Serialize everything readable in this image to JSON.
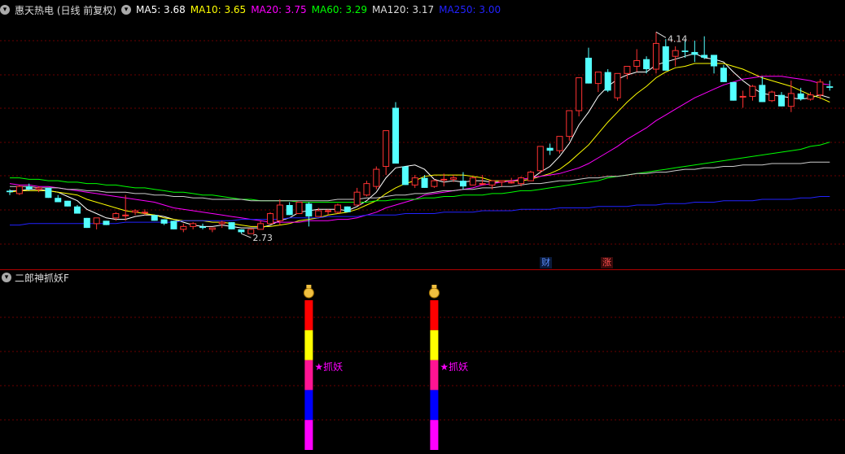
{
  "header": {
    "stock_title": "惠天热电 (日线 前复权)",
    "ma": [
      {
        "label": "MA5: 3.68",
        "color": "#ffffff"
      },
      {
        "label": "MA10: 3.65",
        "color": "#ffff00"
      },
      {
        "label": "MA20: 3.75",
        "color": "#ff00ff"
      },
      {
        "label": "MA60: 3.29",
        "color": "#00ff00"
      },
      {
        "label": "MA120: 3.17",
        "color": "#dddddd"
      },
      {
        "label": "MA250: 3.00",
        "color": "#2222ff"
      }
    ]
  },
  "price_chart": {
    "price_range": [
      2.6,
      4.25
    ],
    "high_label": "4.14",
    "low_label": "2.73",
    "up_color": "#ff3232",
    "down_color": "#54ffff",
    "candles": [
      [
        3.03,
        3.04,
        3.0,
        3.02
      ],
      [
        3.01,
        3.07,
        3.0,
        3.06
      ],
      [
        3.06,
        3.08,
        3.03,
        3.04
      ],
      [
        3.04,
        3.06,
        3.02,
        3.05
      ],
      [
        3.05,
        3.05,
        2.98,
        2.98
      ],
      [
        2.98,
        3.0,
        2.95,
        2.95
      ],
      [
        2.96,
        2.96,
        2.92,
        2.92
      ],
      [
        2.92,
        2.93,
        2.87,
        2.87
      ],
      [
        2.84,
        2.84,
        2.77,
        2.77
      ],
      [
        2.8,
        2.84,
        2.76,
        2.84
      ],
      [
        2.82,
        2.82,
        2.79,
        2.79
      ],
      [
        2.84,
        2.88,
        2.82,
        2.87
      ],
      [
        2.86,
        3.0,
        2.82,
        2.86
      ],
      [
        2.88,
        2.9,
        2.86,
        2.89
      ],
      [
        2.88,
        2.9,
        2.86,
        2.88
      ],
      [
        2.86,
        2.86,
        2.82,
        2.82
      ],
      [
        2.83,
        2.83,
        2.79,
        2.8
      ],
      [
        2.82,
        2.82,
        2.76,
        2.76
      ],
      [
        2.76,
        2.8,
        2.74,
        2.78
      ],
      [
        2.78,
        2.81,
        2.76,
        2.8
      ],
      [
        2.78,
        2.8,
        2.76,
        2.77
      ],
      [
        2.76,
        2.77,
        2.74,
        2.77
      ],
      [
        2.8,
        2.82,
        2.77,
        2.81
      ],
      [
        2.81,
        2.81,
        2.76,
        2.76
      ],
      [
        2.76,
        2.76,
        2.73,
        2.74
      ],
      [
        2.73,
        2.77,
        2.73,
        2.76
      ],
      [
        2.76,
        2.82,
        2.76,
        2.8
      ],
      [
        2.8,
        2.88,
        2.8,
        2.87
      ],
      [
        2.82,
        2.97,
        2.79,
        2.93
      ],
      [
        2.93,
        2.95,
        2.86,
        2.86
      ],
      [
        2.87,
        2.95,
        2.87,
        2.95
      ],
      [
        2.94,
        2.95,
        2.78,
        2.85
      ],
      [
        2.85,
        2.91,
        2.85,
        2.89
      ],
      [
        2.89,
        2.9,
        2.86,
        2.89
      ],
      [
        2.88,
        2.94,
        2.87,
        2.93
      ],
      [
        2.92,
        2.92,
        2.88,
        2.88
      ],
      [
        2.93,
        3.05,
        2.93,
        3.02
      ],
      [
        3.0,
        3.1,
        2.99,
        3.08
      ],
      [
        3.06,
        3.2,
        3.04,
        3.18
      ],
      [
        3.2,
        3.45,
        3.14,
        3.45
      ],
      [
        3.61,
        3.65,
        3.22,
        3.22
      ],
      [
        3.2,
        3.2,
        3.07,
        3.07
      ],
      [
        3.07,
        3.14,
        3.05,
        3.12
      ],
      [
        3.12,
        3.14,
        3.05,
        3.05
      ],
      [
        3.06,
        3.11,
        3.05,
        3.1
      ],
      [
        3.11,
        3.15,
        3.06,
        3.11
      ],
      [
        3.11,
        3.14,
        3.09,
        3.12
      ],
      [
        3.1,
        3.16,
        3.04,
        3.06
      ],
      [
        3.07,
        3.13,
        3.07,
        3.12
      ],
      [
        3.08,
        3.14,
        3.07,
        3.08
      ],
      [
        3.07,
        3.1,
        3.04,
        3.1
      ],
      [
        3.09,
        3.1,
        3.06,
        3.1
      ],
      [
        3.09,
        3.12,
        3.08,
        3.09
      ],
      [
        3.08,
        3.13,
        3.06,
        3.12
      ],
      [
        3.1,
        3.17,
        3.1,
        3.16
      ],
      [
        3.17,
        3.34,
        3.15,
        3.34
      ],
      [
        3.33,
        3.36,
        3.28,
        3.31
      ],
      [
        3.31,
        3.41,
        3.29,
        3.41
      ],
      [
        3.41,
        3.59,
        3.38,
        3.59
      ],
      [
        3.59,
        3.82,
        3.55,
        3.82
      ],
      [
        3.96,
        4.03,
        3.78,
        3.78
      ],
      [
        3.78,
        3.86,
        3.72,
        3.86
      ],
      [
        3.86,
        3.88,
        3.72,
        3.73
      ],
      [
        3.68,
        3.85,
        3.66,
        3.85
      ],
      [
        3.85,
        3.9,
        3.81,
        3.9
      ],
      [
        3.9,
        4.02,
        3.86,
        3.94
      ],
      [
        3.95,
        3.97,
        3.85,
        3.88
      ],
      [
        3.88,
        4.14,
        3.85,
        4.06
      ],
      [
        4.04,
        4.09,
        3.87,
        3.87
      ],
      [
        3.97,
        4.04,
        3.9,
        4.01
      ],
      [
        4.01,
        4.08,
        3.96,
        4.0
      ],
      [
        4.0,
        4.08,
        3.93,
        3.98
      ],
      [
        3.98,
        4.11,
        3.95,
        3.96
      ],
      [
        3.98,
        3.98,
        3.85,
        3.9
      ],
      [
        3.89,
        3.91,
        3.79,
        3.79
      ],
      [
        3.79,
        3.79,
        3.66,
        3.66
      ],
      [
        3.69,
        3.73,
        3.61,
        3.69
      ],
      [
        3.69,
        3.77,
        3.66,
        3.76
      ],
      [
        3.77,
        3.83,
        3.65,
        3.65
      ],
      [
        3.66,
        3.73,
        3.65,
        3.72
      ],
      [
        3.7,
        3.72,
        3.62,
        3.62
      ],
      [
        3.62,
        3.8,
        3.58,
        3.71
      ],
      [
        3.71,
        3.75,
        3.66,
        3.67
      ],
      [
        3.67,
        3.72,
        3.66,
        3.7
      ],
      [
        3.7,
        3.81,
        3.67,
        3.79
      ],
      [
        3.76,
        3.8,
        3.73,
        3.75
      ]
    ],
    "ma_lines": {
      "ma5": [
        3.03,
        3.03,
        3.04,
        3.04,
        3.03,
        3.02,
        2.99,
        2.96,
        2.9,
        2.87,
        2.84,
        2.83,
        2.83,
        2.85,
        2.86,
        2.86,
        2.85,
        2.83,
        2.81,
        2.79,
        2.78,
        2.78,
        2.79,
        2.78,
        2.77,
        2.77,
        2.77,
        2.79,
        2.82,
        2.84,
        2.88,
        2.89,
        2.9,
        2.9,
        2.9,
        2.89,
        2.92,
        2.96,
        3.02,
        3.12,
        3.19,
        3.2,
        3.21,
        3.18,
        3.11,
        3.09,
        3.1,
        3.09,
        3.1,
        3.1,
        3.09,
        3.09,
        3.1,
        3.1,
        3.11,
        3.16,
        3.2,
        3.27,
        3.36,
        3.49,
        3.58,
        3.69,
        3.76,
        3.81,
        3.84,
        3.86,
        3.86,
        3.91,
        3.93,
        3.95,
        3.97,
        3.99,
        3.96,
        3.95,
        3.93,
        3.86,
        3.8,
        3.75,
        3.71,
        3.7,
        3.69,
        3.68,
        3.67,
        3.68,
        3.7,
        3.68
      ],
      "ma10": [
        3.02,
        3.03,
        3.03,
        3.03,
        3.03,
        3.02,
        3.01,
        3.0,
        2.97,
        2.95,
        2.93,
        2.91,
        2.89,
        2.88,
        2.87,
        2.86,
        2.84,
        2.83,
        2.82,
        2.82,
        2.82,
        2.81,
        2.81,
        2.8,
        2.79,
        2.78,
        2.78,
        2.78,
        2.79,
        2.8,
        2.82,
        2.83,
        2.84,
        2.86,
        2.87,
        2.88,
        2.9,
        2.93,
        2.96,
        3.01,
        3.05,
        3.08,
        3.1,
        3.13,
        3.14,
        3.14,
        3.14,
        3.14,
        3.13,
        3.12,
        3.1,
        3.1,
        3.1,
        3.1,
        3.11,
        3.13,
        3.15,
        3.18,
        3.23,
        3.29,
        3.35,
        3.43,
        3.51,
        3.58,
        3.65,
        3.71,
        3.76,
        3.82,
        3.86,
        3.89,
        3.9,
        3.92,
        3.92,
        3.92,
        3.92,
        3.9,
        3.88,
        3.85,
        3.82,
        3.8,
        3.78,
        3.76,
        3.73,
        3.7,
        3.68,
        3.65
      ],
      "ma20": [
        3.08,
        3.07,
        3.07,
        3.06,
        3.06,
        3.05,
        3.04,
        3.03,
        3.02,
        3.01,
        3.0,
        2.99,
        2.98,
        2.97,
        2.96,
        2.95,
        2.93,
        2.91,
        2.9,
        2.89,
        2.88,
        2.87,
        2.86,
        2.85,
        2.84,
        2.83,
        2.82,
        2.81,
        2.81,
        2.81,
        2.81,
        2.82,
        2.82,
        2.82,
        2.83,
        2.83,
        2.84,
        2.86,
        2.88,
        2.91,
        2.93,
        2.95,
        2.97,
        3.0,
        3.01,
        3.02,
        3.03,
        3.04,
        3.05,
        3.07,
        3.08,
        3.09,
        3.1,
        3.11,
        3.12,
        3.13,
        3.14,
        3.15,
        3.17,
        3.19,
        3.22,
        3.26,
        3.3,
        3.34,
        3.39,
        3.43,
        3.47,
        3.52,
        3.56,
        3.6,
        3.64,
        3.68,
        3.71,
        3.74,
        3.77,
        3.79,
        3.81,
        3.82,
        3.83,
        3.83,
        3.83,
        3.82,
        3.81,
        3.8,
        3.78,
        3.77
      ],
      "ma60": [
        3.12,
        3.12,
        3.11,
        3.11,
        3.1,
        3.1,
        3.09,
        3.09,
        3.08,
        3.08,
        3.07,
        3.07,
        3.06,
        3.05,
        3.05,
        3.04,
        3.03,
        3.02,
        3.02,
        3.01,
        3.0,
        3.0,
        2.99,
        2.98,
        2.97,
        2.97,
        2.96,
        2.96,
        2.96,
        2.96,
        2.95,
        2.95,
        2.95,
        2.95,
        2.95,
        2.95,
        2.95,
        2.95,
        2.96,
        2.96,
        2.97,
        2.97,
        2.97,
        2.98,
        2.98,
        2.99,
        2.99,
        3.0,
        3.0,
        3.0,
        3.01,
        3.01,
        3.02,
        3.03,
        3.03,
        3.04,
        3.05,
        3.06,
        3.07,
        3.08,
        3.09,
        3.1,
        3.12,
        3.13,
        3.14,
        3.15,
        3.16,
        3.17,
        3.18,
        3.19,
        3.2,
        3.21,
        3.22,
        3.23,
        3.24,
        3.25,
        3.26,
        3.27,
        3.28,
        3.29,
        3.3,
        3.31,
        3.32,
        3.34,
        3.35,
        3.37
      ],
      "ma120": [
        3.06,
        3.06,
        3.06,
        3.05,
        3.05,
        3.05,
        3.04,
        3.04,
        3.03,
        3.03,
        3.02,
        3.02,
        3.02,
        3.01,
        3.01,
        3.0,
        3.0,
        2.99,
        2.99,
        2.98,
        2.98,
        2.97,
        2.97,
        2.97,
        2.97,
        2.96,
        2.96,
        2.96,
        2.96,
        2.96,
        2.96,
        2.96,
        2.96,
        2.96,
        2.97,
        2.97,
        2.97,
        2.98,
        2.98,
        2.99,
        3.0,
        3.0,
        3.01,
        3.01,
        3.02,
        3.03,
        3.03,
        3.04,
        3.04,
        3.05,
        3.05,
        3.06,
        3.06,
        3.07,
        3.08,
        3.08,
        3.09,
        3.1,
        3.1,
        3.11,
        3.12,
        3.12,
        3.13,
        3.13,
        3.14,
        3.15,
        3.15,
        3.16,
        3.16,
        3.17,
        3.18,
        3.18,
        3.19,
        3.19,
        3.2,
        3.2,
        3.21,
        3.21,
        3.21,
        3.22,
        3.22,
        3.22,
        3.22,
        3.23,
        3.23,
        3.23
      ],
      "ma250": [
        2.79,
        2.79,
        2.8,
        2.8,
        2.8,
        2.8,
        2.8,
        2.8,
        2.8,
        2.8,
        2.8,
        2.8,
        2.81,
        2.81,
        2.81,
        2.81,
        2.81,
        2.81,
        2.82,
        2.82,
        2.82,
        2.82,
        2.82,
        2.82,
        2.83,
        2.83,
        2.83,
        2.83,
        2.83,
        2.84,
        2.84,
        2.84,
        2.84,
        2.85,
        2.85,
        2.85,
        2.85,
        2.86,
        2.86,
        2.86,
        2.86,
        2.87,
        2.87,
        2.87,
        2.87,
        2.88,
        2.88,
        2.88,
        2.88,
        2.89,
        2.89,
        2.89,
        2.89,
        2.9,
        2.9,
        2.9,
        2.9,
        2.91,
        2.91,
        2.91,
        2.91,
        2.92,
        2.92,
        2.92,
        2.92,
        2.93,
        2.93,
        2.93,
        2.94,
        2.94,
        2.94,
        2.95,
        2.95,
        2.95,
        2.96,
        2.96,
        2.96,
        2.96,
        2.97,
        2.97,
        2.97,
        2.97,
        2.98,
        2.98,
        2.99,
        2.99
      ]
    }
  },
  "events": [
    {
      "label": "财",
      "color": "#5a8cff"
    },
    {
      "label": "涨",
      "color": "#ff5050"
    }
  ],
  "indicator": {
    "name": "二郎神抓妖F",
    "signal_label": "★抓妖",
    "signal_color": "#ff00ff",
    "bar_colors": [
      "#ff0000",
      "#ffff00",
      "#ff1493",
      "#0000ff",
      "#ff00ff"
    ],
    "signal_candles": [
      31,
      44
    ]
  }
}
